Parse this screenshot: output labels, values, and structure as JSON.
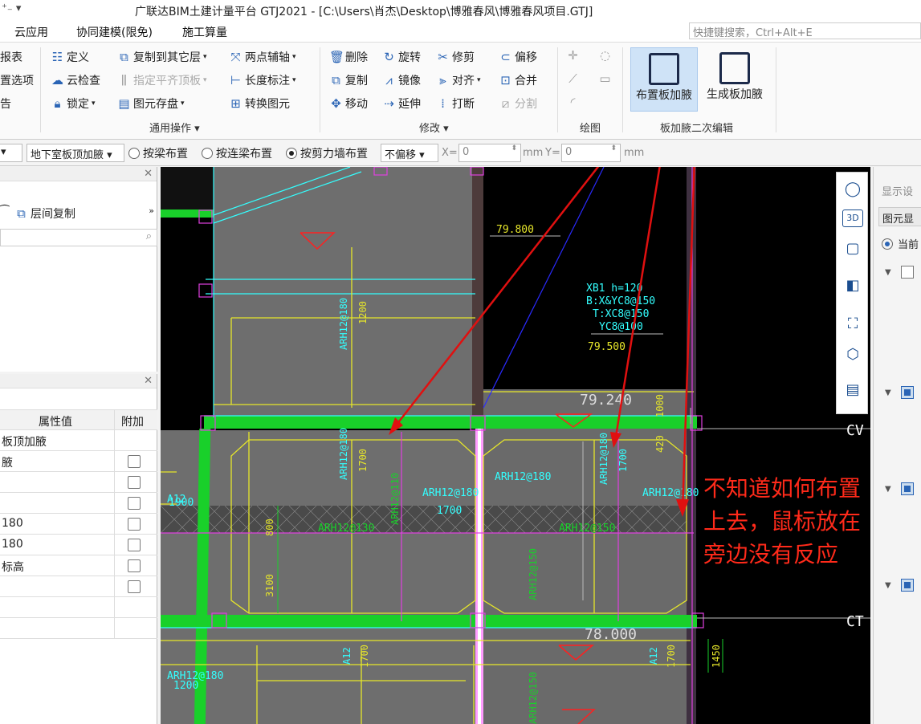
{
  "title_bar": {
    "quick_access": "⁺₋ ▾",
    "title": "广联达BIM土建计量平台 GTJ2021 - [C:\\Users\\肖杰\\Desktop\\博雅春风\\博雅春风项目.GTJ]"
  },
  "menu": {
    "items": [
      "云应用",
      "协同建模(限免)",
      "施工算量"
    ],
    "search_placeholder": "快捷键搜索，Ctrl+Alt+E"
  },
  "ribbon": {
    "left_cut": [
      "报表",
      "置选项",
      "告"
    ],
    "general_ops": {
      "items": [
        "定义",
        "云检查",
        "锁定",
        "复制到其它层",
        "指定平齐顶板",
        "图元存盘",
        "两点辅轴",
        "长度标注",
        "转换图元"
      ],
      "label": "通用操作"
    },
    "modify": {
      "items": [
        "删除",
        "复制",
        "移动",
        "旋转",
        "镜像",
        "延伸",
        "修剪",
        "对齐",
        "打断",
        "偏移",
        "合并",
        "分割"
      ],
      "label": "修改"
    },
    "draw": {
      "label": "绘图"
    },
    "haunch": {
      "place_label": "布置板加腋",
      "generate_label": "生成板加腋",
      "label": "板加腋二次编辑"
    }
  },
  "toolbar": {
    "type_dropdown": "地下室板顶加腋",
    "radio_beam": "按梁布置",
    "radio_link_beam": "按连梁布置",
    "radio_shear_wall": "按剪力墙布置",
    "offset_dropdown": "不偏移",
    "x_label": "X=",
    "x_value": "0",
    "y_label": "Y=",
    "y_value": "0",
    "unit": "mm"
  },
  "left_panel": {
    "floor_copy": "层间复制",
    "prop_header_value": "属性值",
    "prop_header_extra": "附加",
    "rows": [
      "板顶加腋",
      "腋",
      "",
      "",
      "180",
      "180",
      "标高",
      "",
      "",
      ""
    ]
  },
  "canvas": {
    "labels": {
      "elev_1": "79.800",
      "slab_info_1": "XB1 h=120",
      "slab_info_2": "B:X&YC8@150",
      "slab_info_3": "T:XC8@150",
      "slab_info_4": "YC8@100",
      "elev_2": "79.500",
      "elev_3": "79.240",
      "elev_4": "78.000",
      "axis_cv": "CV",
      "axis_ct": "CT",
      "rebar_1": "ARH12@180",
      "rebar_2": "ARH12@180",
      "rebar_3": "ARH12@180",
      "rebar_4": "ARH12@180",
      "rebar_5": "ARH12@180",
      "rebar_6": "ARH12@180",
      "rebar_7": "ARH12@180",
      "rebar_8": "ARH12@180",
      "rebar_9": "ARH12@150",
      "rebar_10": "ARH12@150",
      "rebar_11": "ARH12@150",
      "rebar_12": "ARH12@110",
      "rebar_13": "ARH12@130",
      "dim_1200": "1200",
      "dim_1700": "1700",
      "dim_1900": "1900",
      "dim_800": "800",
      "dim_3100": "3100",
      "dim_1000": "1000",
      "dim_420": "420",
      "dim_1450": "1450",
      "a12": "A12"
    }
  },
  "right_panel": {
    "title": "显示设",
    "tab": "图元显",
    "radio": "当前"
  },
  "annotation": {
    "lines": [
      "不知道如何布置",
      "上去，鼠标放在",
      "旁边没有反应"
    ]
  }
}
